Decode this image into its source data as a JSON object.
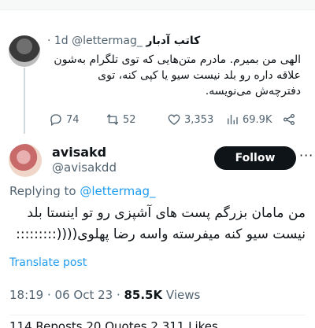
{
  "parent": {
    "name": "کاتب آدبار",
    "handle": "@lettermag_",
    "time": "· 1d",
    "text": "الهی من بمیرم. مادرم متن‌هایی که توی تلگرام به‌شون علاقه داره رو بلد نیست سیو یا کپی کنه، توی دفترچه‌ش می‌نویسه.",
    "stats": {
      "replies": "74",
      "reposts": "52",
      "likes": "3,353",
      "views": "69.9K"
    }
  },
  "reply": {
    "name": "avisakd",
    "handle": "@avisakdd",
    "follow_label": "Follow",
    "more_label": "···",
    "replying_prefix": "Replying to ",
    "replying_to": "@lettermag_",
    "text": "من مامان بزرگم پست های آشپزی رو تو اینستا بلد نیست سیو کنه میفرسته واسه رضا پهلوی((((:::::::::",
    "translate_label": "Translate post",
    "time": "18:19 · 06 Oct 23 · ",
    "views_count": "85.5K",
    "views_label": " Views",
    "bottom_stats": "114 Reposts  20 Quotes  2,311 Likes"
  }
}
